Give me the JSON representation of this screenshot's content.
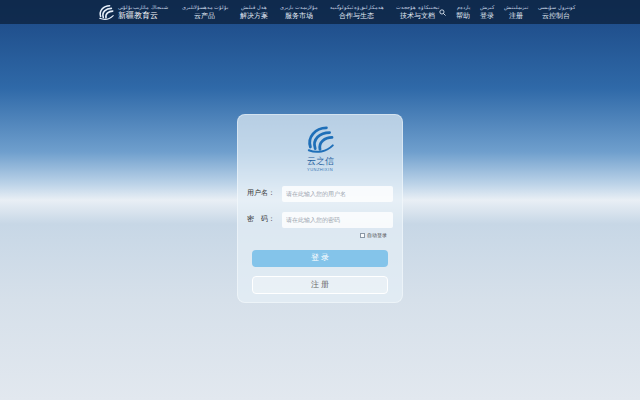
{
  "nav": {
    "logo": {
      "title": "新疆教育云",
      "subtitle": "شىنجاڭ مائارىپ بۇلۇتى"
    },
    "items": [
      {
        "label": "云产品",
        "subtitle": "بۇلۇت مەھسۇلاتلىرى"
      },
      {
        "label": "解决方案",
        "subtitle": "ھەل قىلىش"
      },
      {
        "label": "服务市场",
        "subtitle": "مۇلازىمەت بازىرى"
      },
      {
        "label": "合作与生态",
        "subtitle": "ھەمكارلىق ۋە ئېكولوگىيە"
      },
      {
        "label": "技术与文档",
        "subtitle": "تېخنىكا ۋە ھۆججەت"
      }
    ],
    "right_items": [
      {
        "label": "帮助",
        "subtitle": "ياردەم"
      },
      {
        "label": "登录",
        "subtitle": "كىرىش"
      },
      {
        "label": "注册",
        "subtitle": "تىزىملىتىش"
      },
      {
        "label": "云控制台",
        "subtitle": "كونترول سۇپىسى"
      }
    ]
  },
  "login": {
    "logo": {
      "title": "云之信",
      "subtitle": "YUNZHIXIN"
    },
    "fields": [
      {
        "label": "用户名：",
        "placeholder": "请在此输入您的用户名",
        "kind": "text"
      },
      {
        "label": "密　码：",
        "placeholder": "请在此输入您的密码",
        "kind": "password"
      }
    ],
    "remember": {
      "label": "自动登录",
      "checked": false
    },
    "buttons": [
      {
        "label": "登 录",
        "kind": "primary"
      },
      {
        "label": "注 册",
        "kind": "secondary"
      }
    ]
  }
}
